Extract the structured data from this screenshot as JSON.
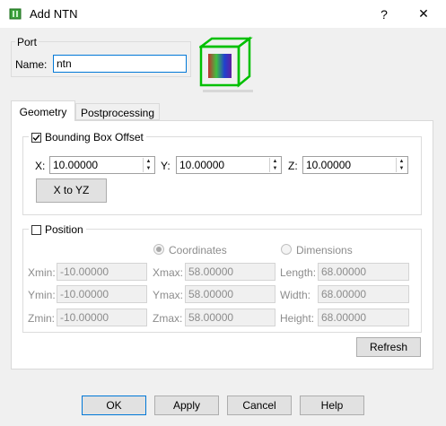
{
  "window": {
    "title": "Add NTN",
    "help_glyph": "?",
    "close_glyph": "✕"
  },
  "port": {
    "group_label": "Port",
    "name_label": "Name:",
    "name_value": "ntn"
  },
  "tabs": [
    {
      "label": "Geometry"
    },
    {
      "label": "Postprocessing"
    }
  ],
  "bbox": {
    "label": "Bounding Box Offset",
    "checked": true,
    "x_label": "X:",
    "x_value": "10.00000",
    "y_label": "Y:",
    "y_value": "10.00000",
    "z_label": "Z:",
    "z_value": "10.00000",
    "x_to_yz_label": "X to YZ"
  },
  "position": {
    "label": "Position",
    "checked": false,
    "coordinates_label": "Coordinates",
    "dimensions_label": "Dimensions",
    "xmin_label": "Xmin:",
    "xmin_value": "-10.00000",
    "ymin_label": "Ymin:",
    "ymin_value": "-10.00000",
    "zmin_label": "Zmin:",
    "zmin_value": "-10.00000",
    "xmax_label": "Xmax:",
    "xmax_value": "58.00000",
    "ymax_label": "Ymax:",
    "ymax_value": "58.00000",
    "zmax_label": "Zmax:",
    "zmax_value": "58.00000",
    "length_label": "Length:",
    "length_value": "68.00000",
    "width_label": "Width:",
    "width_value": "68.00000",
    "height_label": "Height:",
    "height_value": "68.00000"
  },
  "refresh_label": "Refresh",
  "footer": {
    "ok": "OK",
    "apply": "Apply",
    "cancel": "Cancel",
    "help": "Help"
  },
  "colors": {
    "accent": "#0078d7",
    "cube_green": "#00c000"
  }
}
